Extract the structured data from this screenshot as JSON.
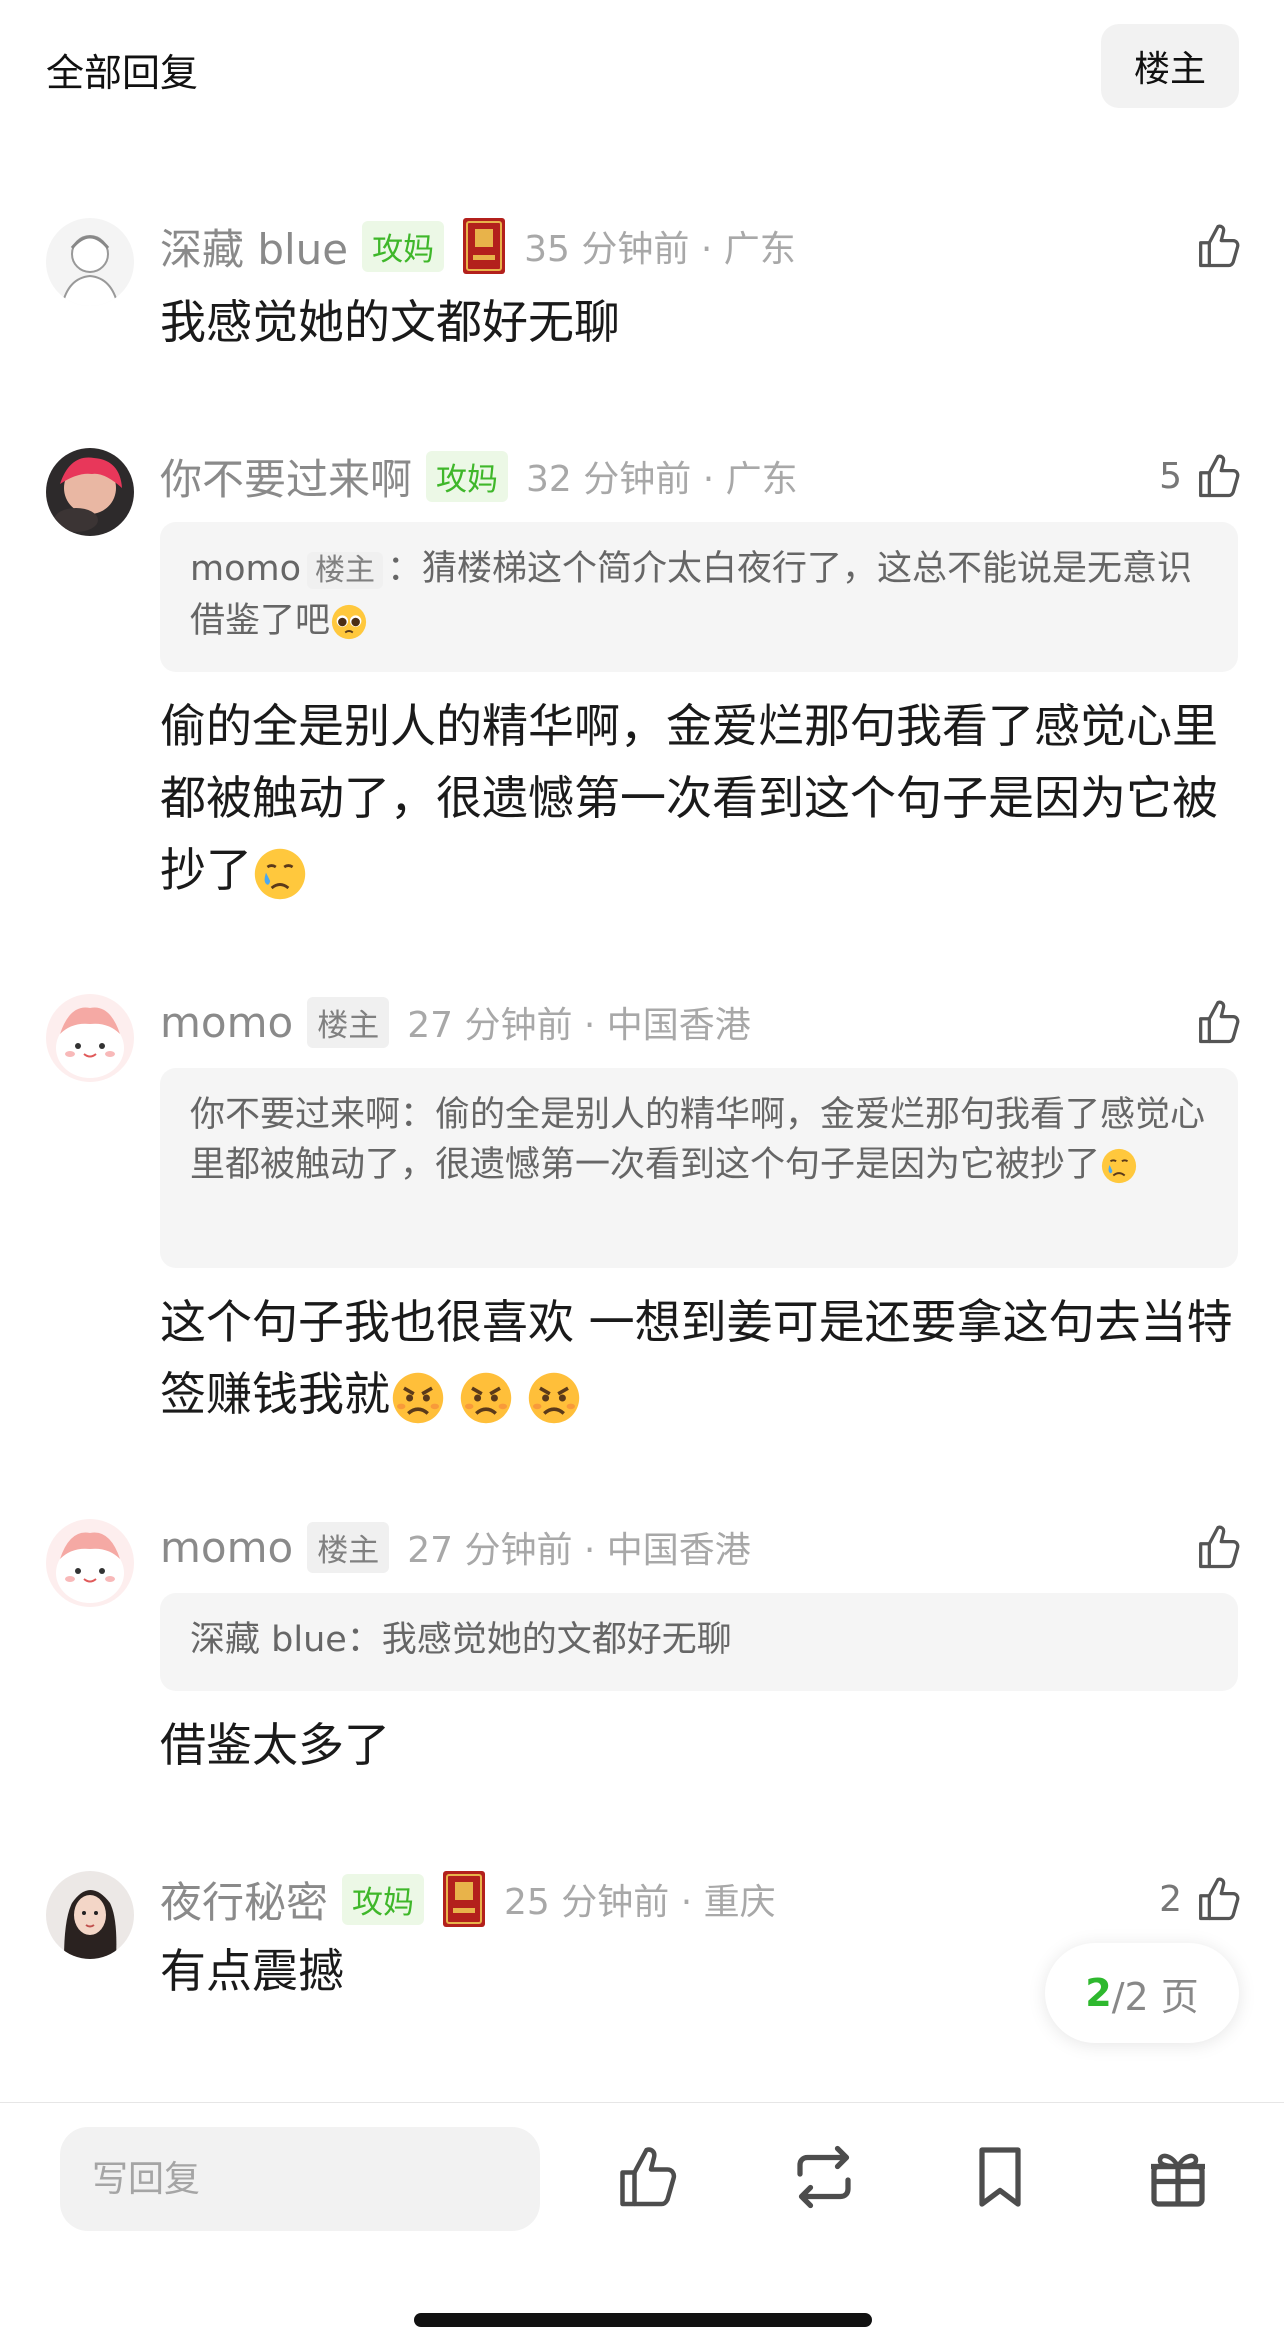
{
  "header": {
    "title": "全部回复",
    "op_filter_label": "楼主"
  },
  "comments": [
    {
      "username": "深藏 blue",
      "badge": "攻妈",
      "time": "35 分钟前 · 广东",
      "likes": "",
      "text": "我感觉她的文都好无聊"
    },
    {
      "username": "你不要过来啊",
      "badge": "攻妈",
      "time": "32 分钟前 · 广东",
      "likes": "5",
      "quote": {
        "author": "momo",
        "author_badge": "楼主",
        "text": "：猜楼梯这个简介太白夜行了，这总不能说是无意识借鉴了吧"
      },
      "text": "偷的全是别人的精华啊，金爱烂那句我看了感觉心里都被触动了，很遗憾第一次看到这个句子是因为它被抄了"
    },
    {
      "username": "momo",
      "badge": "楼主",
      "time": "27 分钟前 · 中国香港",
      "likes": "",
      "quote": {
        "author": "你不要过来啊",
        "author_badge": "",
        "text": "：偷的全是别人的精华啊，金爱烂那句我看了感觉心里都被触动了，很遗憾第一次看到这个句子是因为它被抄了"
      },
      "text": "这个句子我也很喜欢 一想到姜可是还要拿这句去当特签赚钱我就"
    },
    {
      "username": "momo",
      "badge": "楼主",
      "time": "27 分钟前 · 中国香港",
      "likes": "",
      "quote": {
        "author": "深藏 blue",
        "author_badge": "",
        "text": "：我感觉她的文都好无聊"
      },
      "text": "借鉴太多了"
    },
    {
      "username": "夜行秘密",
      "badge": "攻妈",
      "time": "25 分钟前 · 重庆",
      "likes": "2",
      "text": "有点震撼"
    }
  ],
  "pager": {
    "current": "2",
    "total_text": "/2 页"
  },
  "bottom_bar": {
    "reply_placeholder": "写回复"
  },
  "colors": {
    "accent_green": "#3fb72a",
    "medal_red": "#b3201c"
  },
  "icons": [
    "thumbs-up-icon",
    "repost-icon",
    "bookmark-icon",
    "gift-icon"
  ]
}
